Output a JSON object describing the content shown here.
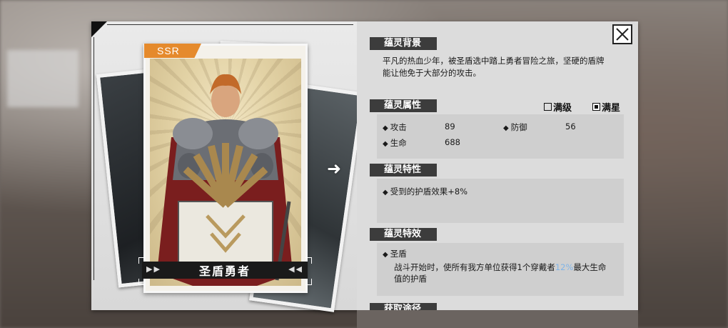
{
  "hero": {
    "rarity": "SSR",
    "name": "圣盾勇者"
  },
  "sections": {
    "background": {
      "title": "蕴灵背景",
      "text_line1": "平凡的热血少年，被圣盾选中踏上勇者冒险之旅，坚硬的盾牌",
      "text_line2": "能让他免于大部分的攻击。"
    },
    "attributes": {
      "title": "蕴灵属性",
      "toggle_max_level": "满级",
      "toggle_max_star": "满星",
      "attack_label": "攻击",
      "attack_value": "89",
      "defense_label": "防御",
      "defense_value": "56",
      "hp_label": "生命",
      "hp_value": "688"
    },
    "traits": {
      "title": "蕴灵特性",
      "item1": "受到的护盾效果+8%"
    },
    "effects": {
      "title": "蕴灵特效",
      "effect_name": "圣盾",
      "desc_line1a": "战斗开始时，使所有我方单位获得1个穿戴者",
      "desc_highlight": "12%",
      "desc_line1b": "最大生命",
      "desc_line2": "值的护盾"
    },
    "obtain": {
      "title": "获取途径"
    }
  },
  "icons": {
    "close": "close-icon",
    "next": "arrow-right-icon",
    "prev_arrow": "double-chevron-left-icon",
    "next_arrow": "double-chevron-right-icon"
  },
  "colors": {
    "rarity_tag": "#e58a2c",
    "header_bg": "#3c3c3c",
    "highlight": "#7fb4e8"
  }
}
